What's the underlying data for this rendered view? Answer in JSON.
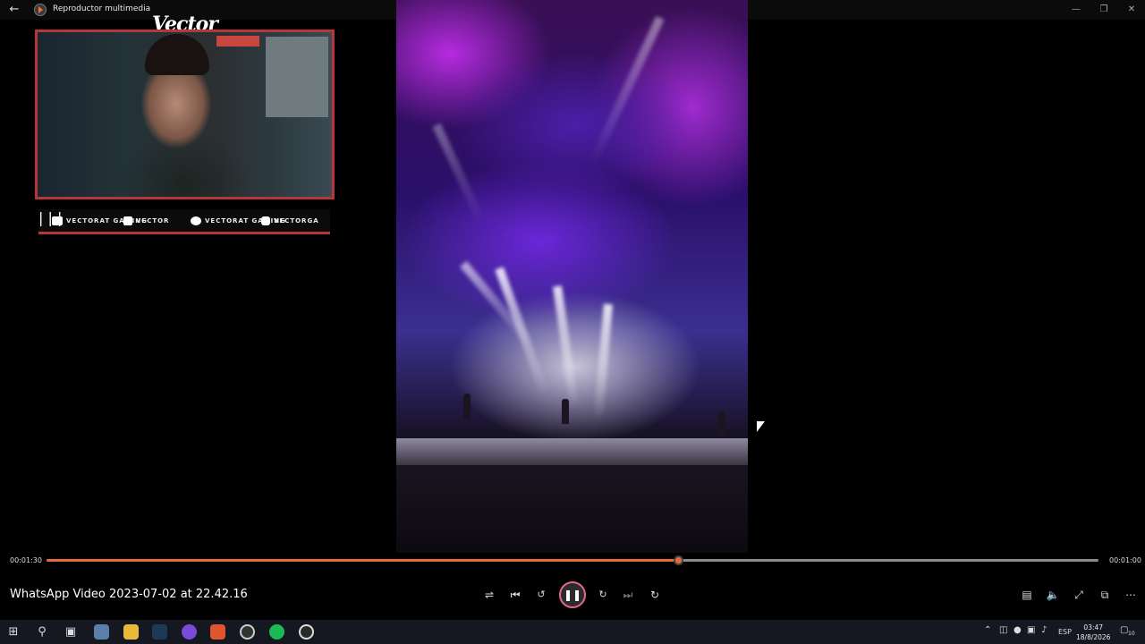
{
  "titlebar": {
    "app_title": "Reproductor multimedia",
    "back_icon": "back-arrow-icon",
    "app_icon": "media-player-icon"
  },
  "overlay": {
    "brand_wordmark": "Vector",
    "socials": [
      {
        "icon": "youtube-icon",
        "label": "VECTORAT GAMING"
      },
      {
        "icon": "twitch-icon",
        "label": "VECTOR"
      },
      {
        "icon": "twitter-icon",
        "label": "VECTORAT GAMING"
      },
      {
        "icon": "instagram-icon",
        "label": "VECTORGA"
      }
    ],
    "frame_color": "#b5373c"
  },
  "player": {
    "elapsed": "00:01:30",
    "remaining": "00:01:00",
    "progress": 0.6,
    "media_title": "WhatsApp Video 2023-07-02 at 22.42.16",
    "accent": "#e86a3c"
  },
  "taskbar": {
    "language": "ESP",
    "time": "03:47",
    "date": "18/8/2026",
    "notifications": "10"
  }
}
